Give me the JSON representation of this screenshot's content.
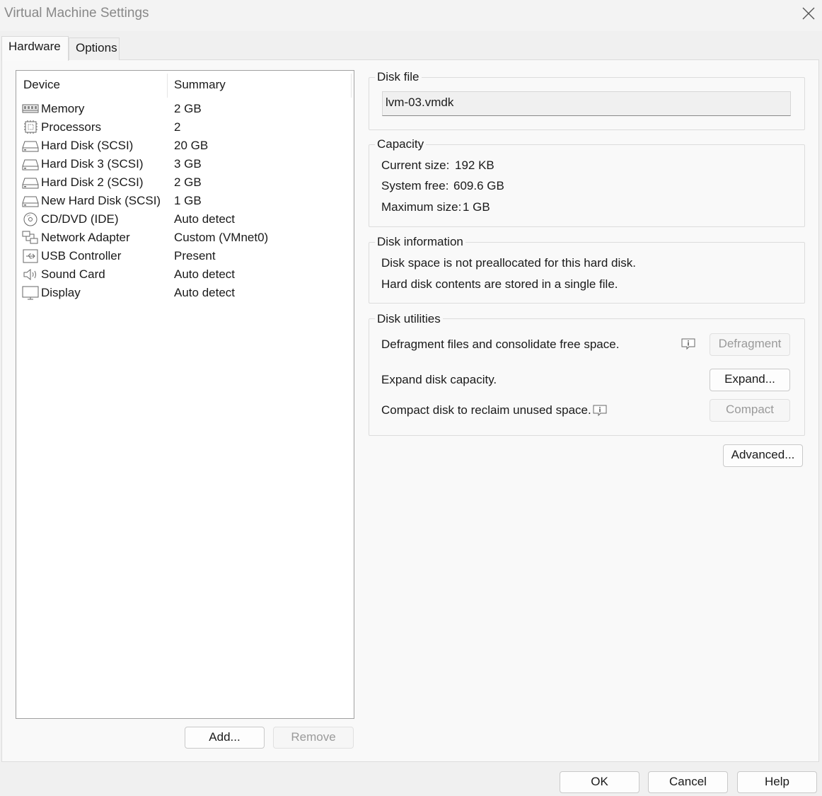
{
  "window": {
    "title": "Virtual Machine Settings"
  },
  "tabs": [
    {
      "label": "Hardware"
    },
    {
      "label": "Options"
    }
  ],
  "device_list": {
    "columns": {
      "device": "Device",
      "summary": "Summary"
    },
    "rows": [
      {
        "name": "Memory",
        "summary": "2 GB",
        "icon": "memory-icon"
      },
      {
        "name": "Processors",
        "summary": "2",
        "icon": "processor-icon"
      },
      {
        "name": "Hard Disk (SCSI)",
        "summary": "20 GB",
        "icon": "hard-disk-icon"
      },
      {
        "name": "Hard Disk 3 (SCSI)",
        "summary": "3 GB",
        "icon": "hard-disk-icon"
      },
      {
        "name": "Hard Disk 2 (SCSI)",
        "summary": "2 GB",
        "icon": "hard-disk-icon"
      },
      {
        "name": "New Hard Disk (SCSI)",
        "summary": "1 GB",
        "icon": "hard-disk-icon"
      },
      {
        "name": "CD/DVD (IDE)",
        "summary": "Auto detect",
        "icon": "cd-dvd-icon"
      },
      {
        "name": "Network Adapter",
        "summary": "Custom (VMnet0)",
        "icon": "network-adapter-icon"
      },
      {
        "name": "USB Controller",
        "summary": "Present",
        "icon": "usb-icon"
      },
      {
        "name": "Sound Card",
        "summary": "Auto detect",
        "icon": "speaker-icon"
      },
      {
        "name": "Display",
        "summary": "Auto detect",
        "icon": "monitor-icon"
      }
    ]
  },
  "device_buttons": {
    "add": "Add...",
    "remove": "Remove"
  },
  "disk_file": {
    "label": "Disk file",
    "value": "lvm-03.vmdk"
  },
  "capacity": {
    "label": "Capacity",
    "current_label": "Current size:",
    "current_value": "192 KB",
    "free_label": "System free:",
    "free_value": "609.6 GB",
    "max_label": "Maximum size:",
    "max_value": "1 GB"
  },
  "disk_information": {
    "label": "Disk information",
    "line1": "Disk space is not preallocated for this hard disk.",
    "line2": "Hard disk contents are stored in a single file."
  },
  "disk_utilities": {
    "label": "Disk utilities",
    "defragment_text": "Defragment files and consolidate free space.",
    "defragment_button": "Defragment",
    "expand_text": "Expand disk capacity.",
    "expand_button": "Expand...",
    "compact_text": "Compact disk to reclaim unused space.",
    "compact_button": "Compact"
  },
  "advanced_button": "Advanced...",
  "dialog_buttons": {
    "ok": "OK",
    "cancel": "Cancel",
    "help": "Help"
  }
}
